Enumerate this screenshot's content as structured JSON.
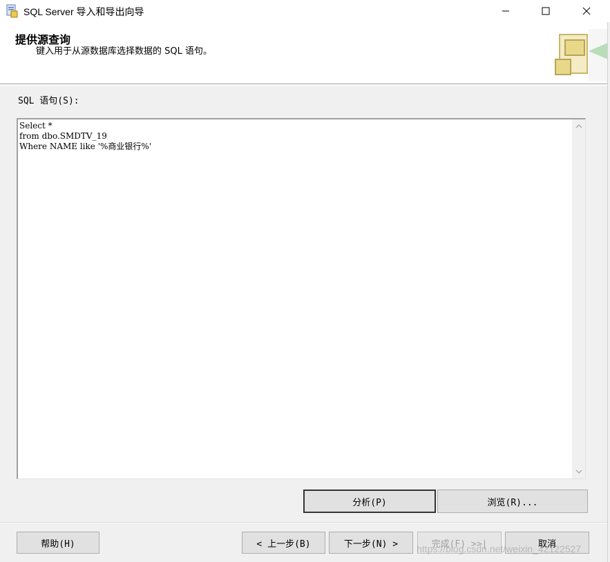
{
  "window": {
    "title": "SQL Server 导入和导出向导",
    "minimize_glyph": "—",
    "maximize_glyph": "☐",
    "close_glyph": "✕"
  },
  "header": {
    "title": "提供源查询",
    "subtitle": "键入用于从源数据库选择数据的 SQL 语句。"
  },
  "sql": {
    "label": "SQL 语句(S):",
    "text": "Select *\nfrom dbo.SMDTV_19\nWhere NAME like '%商业银行%'"
  },
  "buttons": {
    "parse": "分析(P)",
    "browse": "浏览(R)...",
    "help": "帮助(H)",
    "back": "< 上一步(B)",
    "next": "下一步(N) >",
    "finish": "完成(F) >>|",
    "cancel": "取消"
  },
  "watermark": "https://blog.csdn.net/weixin_42122527",
  "colors": {
    "dialog_bg": "#f0f0f0",
    "button_face": "#e1e1e1",
    "header_art_yellow": "#e8d88a",
    "header_art_green": "#6fc16f"
  }
}
